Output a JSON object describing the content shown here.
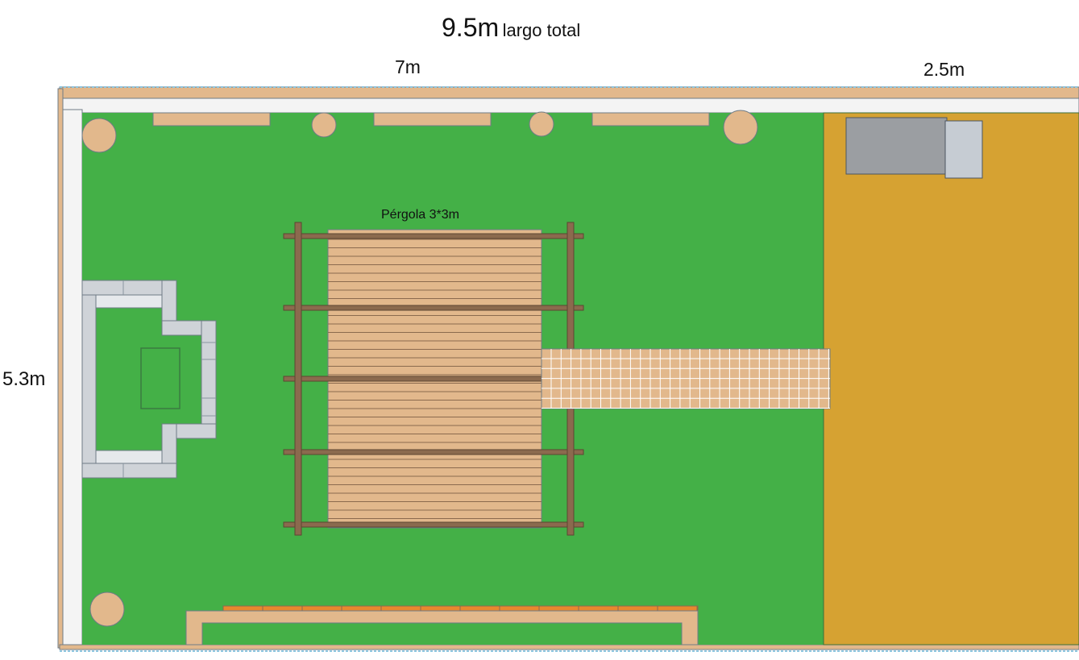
{
  "labels": {
    "total_value": "9.5m",
    "total_text": "largo total",
    "green_width": "7m",
    "deck_width": "2.5m",
    "height": "5.3m",
    "pergola": "Pérgola 3*3m"
  },
  "colors": {
    "lawn": "#44b047",
    "deck": "#d6a232",
    "wall": "#e2b88c",
    "wall_white": "#f4f4f4",
    "pergola_slats": "#e2b88c",
    "pergola_beams": "#8b6a4e",
    "stone": "#cfd3d8",
    "furniture_gray": "#9b9ea2",
    "path_tiles": "#e2b88c",
    "bench_orange": "#e8892e",
    "planter": "#e2b88c"
  }
}
